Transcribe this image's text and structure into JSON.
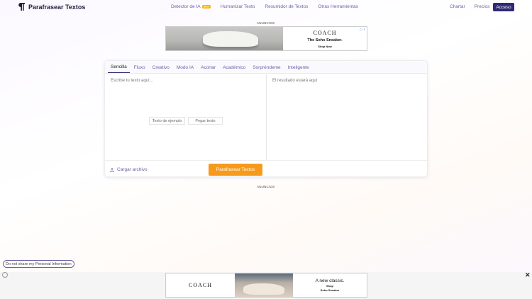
{
  "header": {
    "logo_text": "Parafrasear Textos",
    "nav": [
      {
        "label": "Detector de IA",
        "badge": "NEW"
      },
      {
        "label": "Humanizar Texto"
      },
      {
        "label": "Resumidor de Textos"
      },
      {
        "label": "Otras Herramientas"
      }
    ],
    "right_nav": [
      "Chartar",
      "Precios"
    ],
    "access_label": "Acceso"
  },
  "ads": {
    "label_top": "ANUNCIOS",
    "label_bottom": "ANUNCIOS",
    "top": {
      "brand": "COACH",
      "headline": "The Soho Sneaker.",
      "cta": "Shop Now"
    },
    "bottom": {
      "brand": "COACH",
      "headline": "A new classic.",
      "line1": "Shop",
      "line2": "Soho Sneaker"
    }
  },
  "tool": {
    "tabs": [
      {
        "label": "Sencilla",
        "active": true
      },
      {
        "label": "Fluxo"
      },
      {
        "label": "Creativo"
      },
      {
        "label": "Modo IA"
      },
      {
        "label": "Acortar"
      },
      {
        "label": "Académico"
      },
      {
        "label": "Sorpréndeme"
      },
      {
        "label": "Inteligente"
      }
    ],
    "input_placeholder": "Escribe tu texto aquí...",
    "output_placeholder": "El resultado estará aquí",
    "sample_label": "Texto de ejemplo",
    "paste_label": "Pegar texto",
    "upload_label": "Cargar archivo",
    "paraphrase_label": "Parafrasear Textos"
  },
  "privacy_label": "Do not share my Personal Information",
  "colors": {
    "accent": "#2f2a73",
    "primary_button": "#f79a1c",
    "link": "#6b5fa8"
  }
}
